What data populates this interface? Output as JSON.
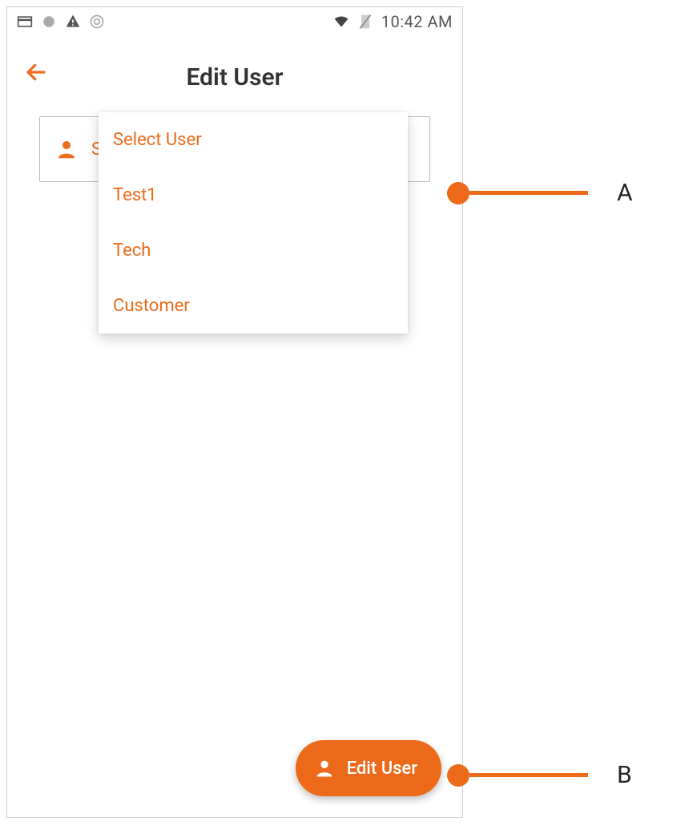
{
  "status_bar": {
    "time": "10:42 AM",
    "icons_left": [
      "card",
      "circle",
      "warning",
      "sync"
    ],
    "icons_right": [
      "wifi",
      "no-sim"
    ]
  },
  "header": {
    "title": "Edit User"
  },
  "select": {
    "placeholder": "Select User",
    "options": [
      "Select User",
      "Test1",
      "Tech",
      "Customer"
    ]
  },
  "fab": {
    "label": "Edit User"
  },
  "callouts": {
    "a": "A",
    "b": "B"
  },
  "colors": {
    "accent": "#ed6a1a"
  }
}
